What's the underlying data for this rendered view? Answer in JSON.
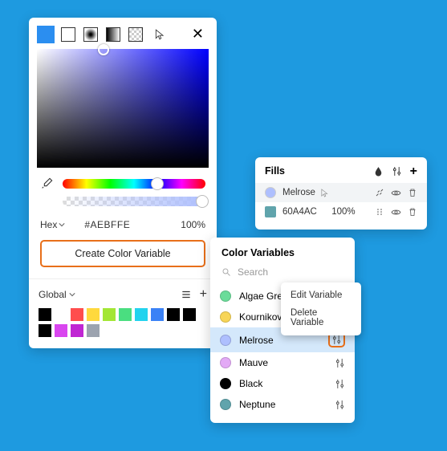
{
  "picker": {
    "format_label": "Hex",
    "hex_value": "#AEBFFE",
    "opacity": "100%",
    "create_btn": "Create Color Variable",
    "global_label": "Global",
    "swatches": [
      "#000000",
      "#ffffff",
      "#ff4d4d",
      "#ffd93d",
      "#a3e635",
      "#4ade80",
      "#22d3ee",
      "#3b82f6",
      "#000000",
      "#000000",
      "#000000",
      "#d946ef",
      "#c026d3",
      "#9ca3af"
    ]
  },
  "fills": {
    "title": "Fills",
    "rows": [
      {
        "name": "Melrose",
        "color": "#aebffe",
        "type": "var"
      },
      {
        "name": "60A4AC",
        "color": "#60a4ac",
        "opacity": "100%",
        "type": "hex"
      }
    ]
  },
  "colorvars": {
    "title": "Color Variables",
    "search_placeholder": "Search",
    "items": [
      {
        "name": "Algae Green",
        "color": "#6bdc9a"
      },
      {
        "name": "Kournikova",
        "color": "#f7d558"
      },
      {
        "name": "Melrose",
        "color": "#aebffe",
        "selected": true
      },
      {
        "name": "Mauve",
        "color": "#e3aaf6"
      },
      {
        "name": "Black",
        "color": "#000000"
      },
      {
        "name": "Neptune",
        "color": "#60a4ac"
      }
    ]
  },
  "context_menu": {
    "edit": "Edit Variable",
    "delete": "Delete Variable"
  }
}
